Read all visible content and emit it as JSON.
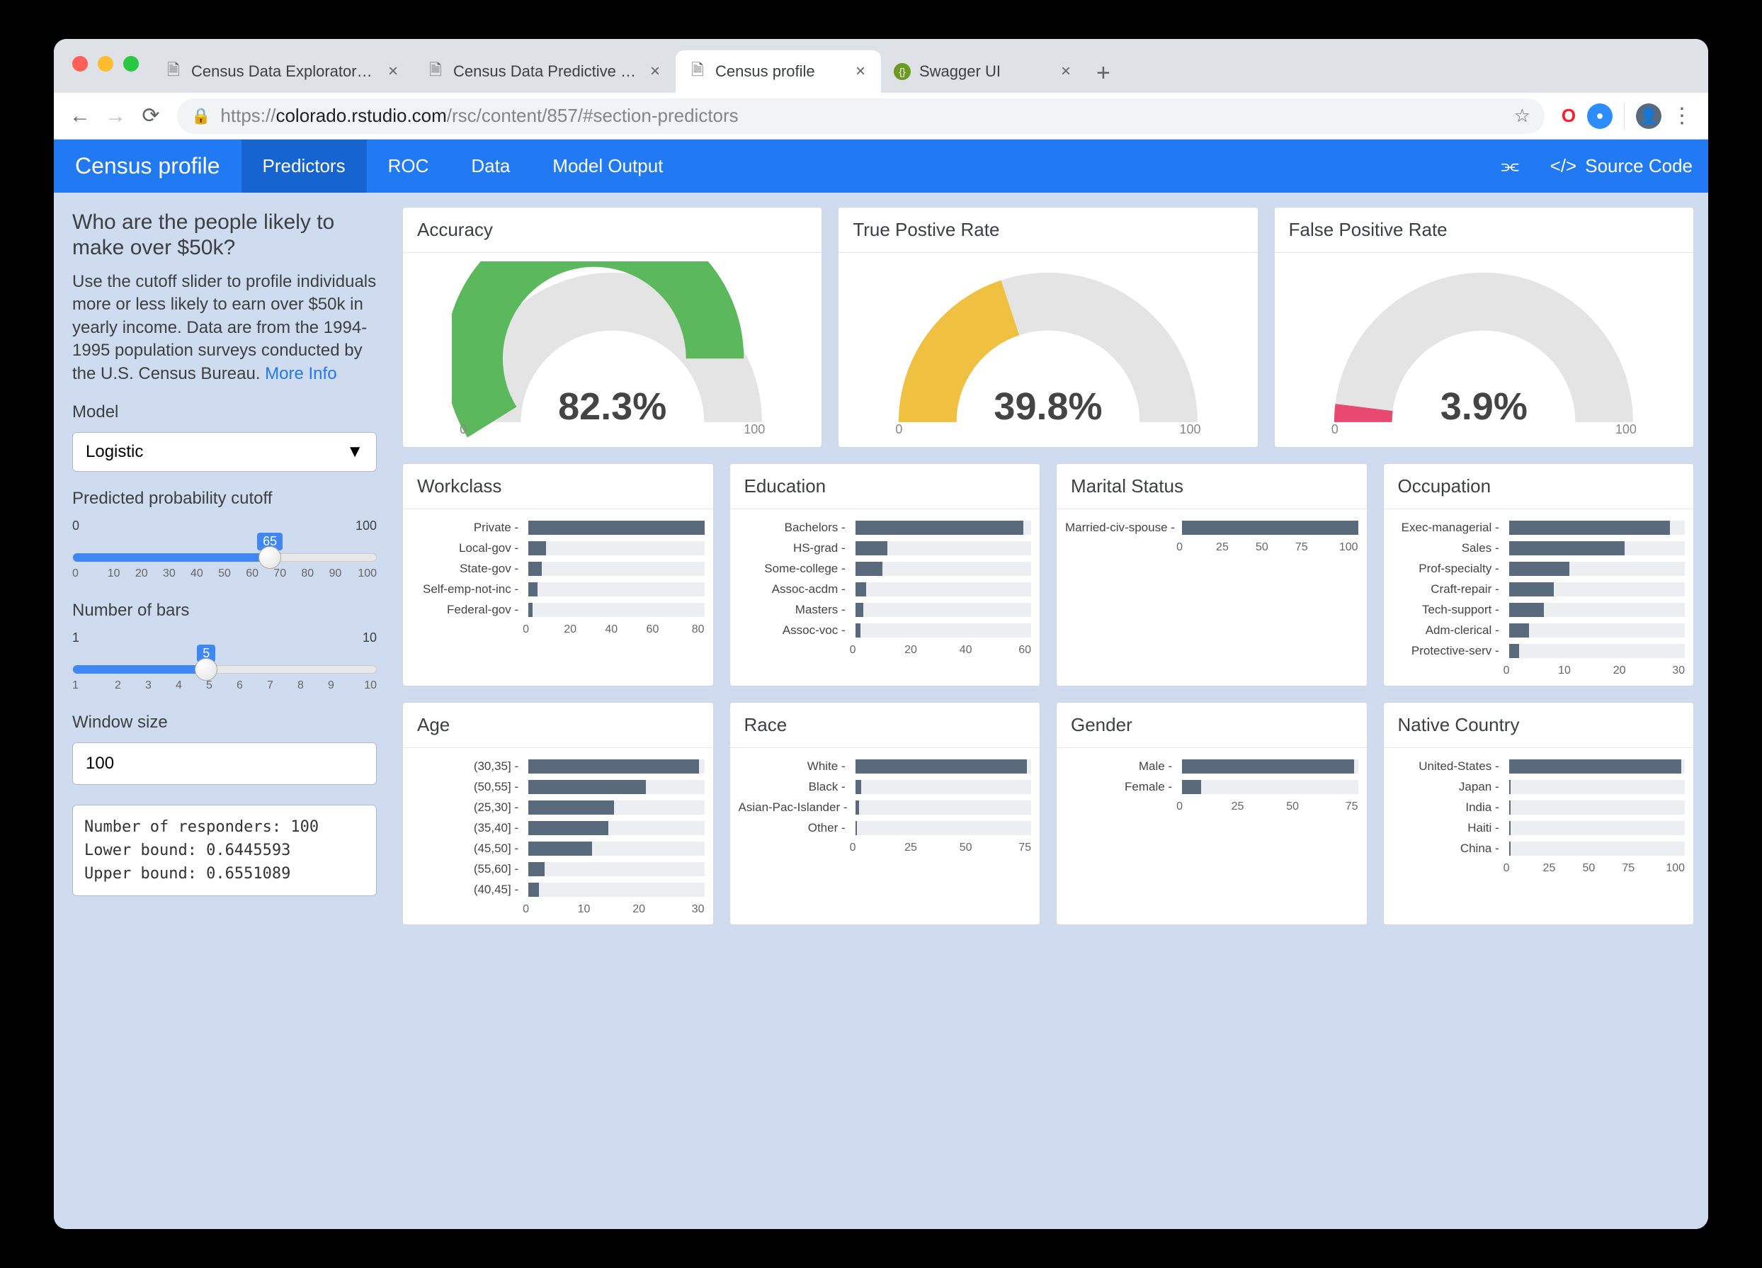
{
  "browser": {
    "tabs": [
      {
        "title": "Census Data Exploratory Analy",
        "active": false,
        "icon": "file"
      },
      {
        "title": "Census Data Predictive Models",
        "active": false,
        "icon": "file"
      },
      {
        "title": "Census profile",
        "active": true,
        "icon": "file"
      },
      {
        "title": "Swagger UI",
        "active": false,
        "icon": "swagger"
      }
    ],
    "url_prefix": "https://",
    "url_host": "colorado.rstudio.com",
    "url_path": "/rsc/content/857/#section-predictors"
  },
  "appbar": {
    "brand": "Census profile",
    "tabs": [
      "Predictors",
      "ROC",
      "Data",
      "Model Output"
    ],
    "selected": 0,
    "source": "Source Code"
  },
  "sidebar": {
    "title": "Who are the people likely to make over $50k?",
    "desc_text": "Use the cutoff slider to profile individuals more or less likely to earn over $50k in yearly income. Data are from the 1994-1995 population surveys conducted by the U.S. Census Bureau. ",
    "more_info": "More Info",
    "model_label": "Model",
    "model_value": "Logistic",
    "cutoff_label": "Predicted probability cutoff",
    "cutoff_min": "0",
    "cutoff_max": "100",
    "cutoff_val": "65",
    "cutoff_pct": 65,
    "cutoff_ticks": [
      "0",
      "10",
      "20",
      "30",
      "40",
      "50",
      "60",
      "70",
      "80",
      "90",
      "100"
    ],
    "bars_label": "Number of bars",
    "bars_min": "1",
    "bars_max": "10",
    "bars_val": "5",
    "bars_pct": 44,
    "bars_ticks": [
      "1",
      "2",
      "3",
      "4",
      "5",
      "6",
      "7",
      "8",
      "9",
      "10"
    ],
    "window_label": "Window size",
    "window_value": "100",
    "stats_l1": "Number of responders: 100",
    "stats_l2": "Lower bound: 0.6445593",
    "stats_l3": "Upper bound: 0.6551089"
  },
  "gauges": {
    "accuracy": {
      "title": "Accuracy",
      "value": "82.3%",
      "pct": 82.3,
      "color": "#5bb85c",
      "min": "0",
      "max": "100"
    },
    "tpr": {
      "title": "True Postive Rate",
      "value": "39.8%",
      "pct": 39.8,
      "color": "#f0c040",
      "min": "0",
      "max": "100"
    },
    "fpr": {
      "title": "False Positive Rate",
      "value": "3.9%",
      "pct": 3.9,
      "color": "#e74a6e",
      "min": "0",
      "max": "100"
    }
  },
  "chart_data": [
    {
      "type": "bar",
      "orientation": "horizontal",
      "title": "Workclass",
      "categories": [
        "Private",
        "Local-gov",
        "State-gov",
        "Self-emp-not-inc",
        "Federal-gov"
      ],
      "values": [
        80,
        8,
        6,
        4,
        2
      ],
      "xticks": [
        "0",
        "20",
        "40",
        "60",
        "80"
      ],
      "xlim": [
        0,
        80
      ]
    },
    {
      "type": "bar",
      "orientation": "horizontal",
      "title": "Education",
      "categories": [
        "Bachelors",
        "HS-grad",
        "Some-college",
        "Assoc-acdm",
        "Masters",
        "Assoc-voc"
      ],
      "values": [
        62,
        12,
        10,
        4,
        3,
        2
      ],
      "xticks": [
        "0",
        "20",
        "40",
        "60"
      ],
      "xlim": [
        0,
        65
      ]
    },
    {
      "type": "bar",
      "orientation": "horizontal",
      "title": "Marital Status",
      "categories": [
        "Married-civ-spouse"
      ],
      "values": [
        100
      ],
      "xticks": [
        "0",
        "25",
        "50",
        "75",
        "100"
      ],
      "xlim": [
        0,
        100
      ]
    },
    {
      "type": "bar",
      "orientation": "horizontal",
      "title": "Occupation",
      "categories": [
        "Exec-managerial",
        "Sales",
        "Prof-specialty",
        "Craft-repair",
        "Tech-support",
        "Adm-clerical",
        "Protective-serv"
      ],
      "values": [
        32,
        23,
        12,
        9,
        7,
        4,
        2
      ],
      "xticks": [
        "0",
        "10",
        "20",
        "30"
      ],
      "xlim": [
        0,
        35
      ]
    },
    {
      "type": "bar",
      "orientation": "horizontal",
      "title": "Age",
      "categories": [
        "(30,35]",
        "(50,55]",
        "(25,30]",
        "(35,40]",
        "(45,50]",
        "(55,60]",
        "(40,45]"
      ],
      "values": [
        32,
        22,
        16,
        15,
        12,
        3,
        2
      ],
      "xticks": [
        "0",
        "10",
        "20",
        "30"
      ],
      "xlim": [
        0,
        33
      ]
    },
    {
      "type": "bar",
      "orientation": "horizontal",
      "title": "Race",
      "categories": [
        "White",
        "Black",
        "Asian-Pac-Islander",
        "Other"
      ],
      "values": [
        88,
        3,
        2,
        1
      ],
      "xticks": [
        "0",
        "25",
        "50",
        "75"
      ],
      "xlim": [
        0,
        90
      ]
    },
    {
      "type": "bar",
      "orientation": "horizontal",
      "title": "Gender",
      "categories": [
        "Male",
        "Female"
      ],
      "values": [
        90,
        10
      ],
      "xticks": [
        "0",
        "25",
        "50",
        "75"
      ],
      "xlim": [
        0,
        92
      ]
    },
    {
      "type": "bar",
      "orientation": "horizontal",
      "title": "Native Country",
      "categories": [
        "United-States",
        "Japan",
        "India",
        "Haiti",
        "China"
      ],
      "values": [
        98,
        1,
        1,
        1,
        1
      ],
      "xticks": [
        "0",
        "25",
        "50",
        "75",
        "100"
      ],
      "xlim": [
        0,
        100
      ]
    }
  ]
}
